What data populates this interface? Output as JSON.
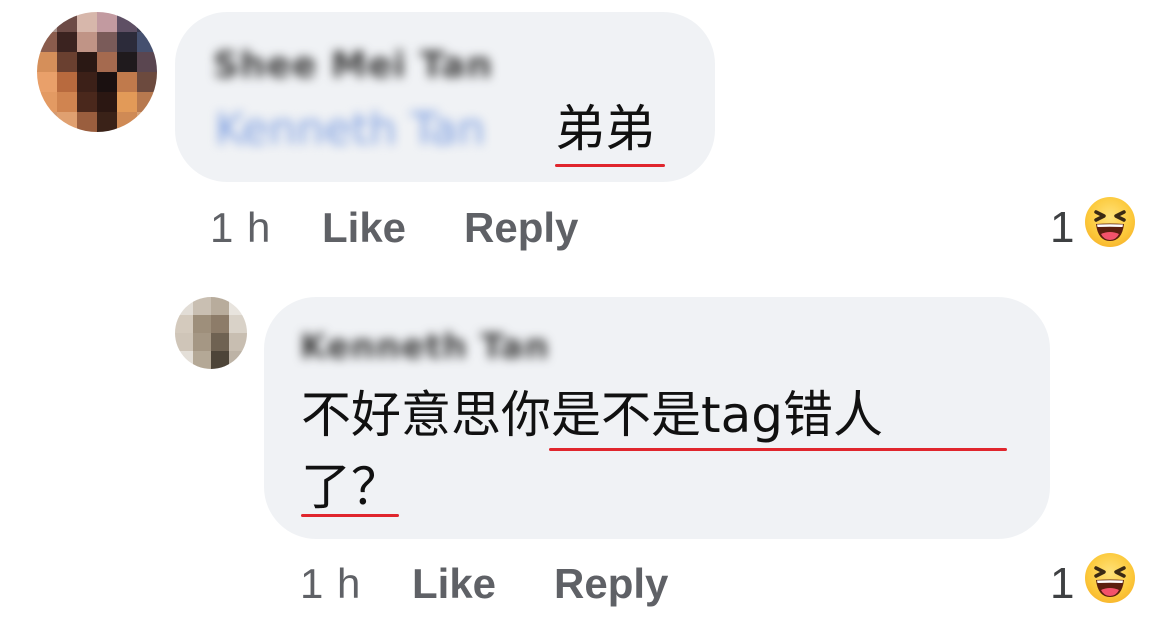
{
  "comments": [
    {
      "author": "Shee Mei Tan",
      "mention": "Kenneth Tan",
      "text": "弟弟",
      "time": "1 h",
      "like_label": "Like",
      "reply_label": "Reply",
      "reaction_count": "1",
      "reaction_icon": "haha-emoji-icon"
    },
    {
      "author": "Kenneth Tan",
      "text_line1": "不好意思你是不是tag错人",
      "text_line2": "了？",
      "time": "1 h",
      "like_label": "Like",
      "reply_label": "Reply",
      "reaction_count": "1",
      "reaction_icon": "haha-emoji-icon"
    }
  ],
  "colors": {
    "bubble": "#f0f2f5",
    "underline": "#e0262d",
    "mention": "#7e9fe0",
    "meta": "#5f6166"
  }
}
